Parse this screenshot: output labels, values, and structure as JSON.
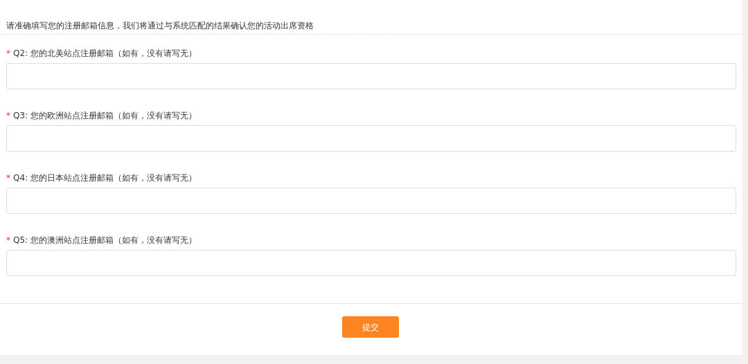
{
  "intro": "请准确填写您的注册邮箱信息，我们将通过与系统匹配的结果确认您的活动出席资格",
  "questions": [
    {
      "required_mark": "*",
      "label": "Q2: 您的北美站点注册邮箱（如有，没有请写无）"
    },
    {
      "required_mark": "*",
      "label": "Q3: 您的欧洲站点注册邮箱（如有，没有请写无）"
    },
    {
      "required_mark": "*",
      "label": "Q4: 您的日本站点注册邮箱（如有，没有请写无）"
    },
    {
      "required_mark": "*",
      "label": "Q5: 您的澳洲站点注册邮箱（如有，没有请写无）"
    }
  ],
  "submit_button": "提交"
}
